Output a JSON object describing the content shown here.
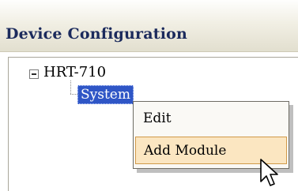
{
  "header": {
    "title": "Device Configuration"
  },
  "tree": {
    "root": {
      "label": "HRT-710",
      "expander": "minus-icon"
    },
    "child": {
      "label": "System",
      "selected": true
    }
  },
  "context_menu": {
    "items": [
      {
        "label": "Edit",
        "highlighted": false
      },
      {
        "label": "Add Module",
        "highlighted": true
      }
    ]
  },
  "colors": {
    "selection": "#2f56c6",
    "menu_highlight": "#fbe6c1",
    "title_text": "#1b2a5c"
  },
  "icons": {
    "pointer": "mouse-pointer-icon"
  }
}
